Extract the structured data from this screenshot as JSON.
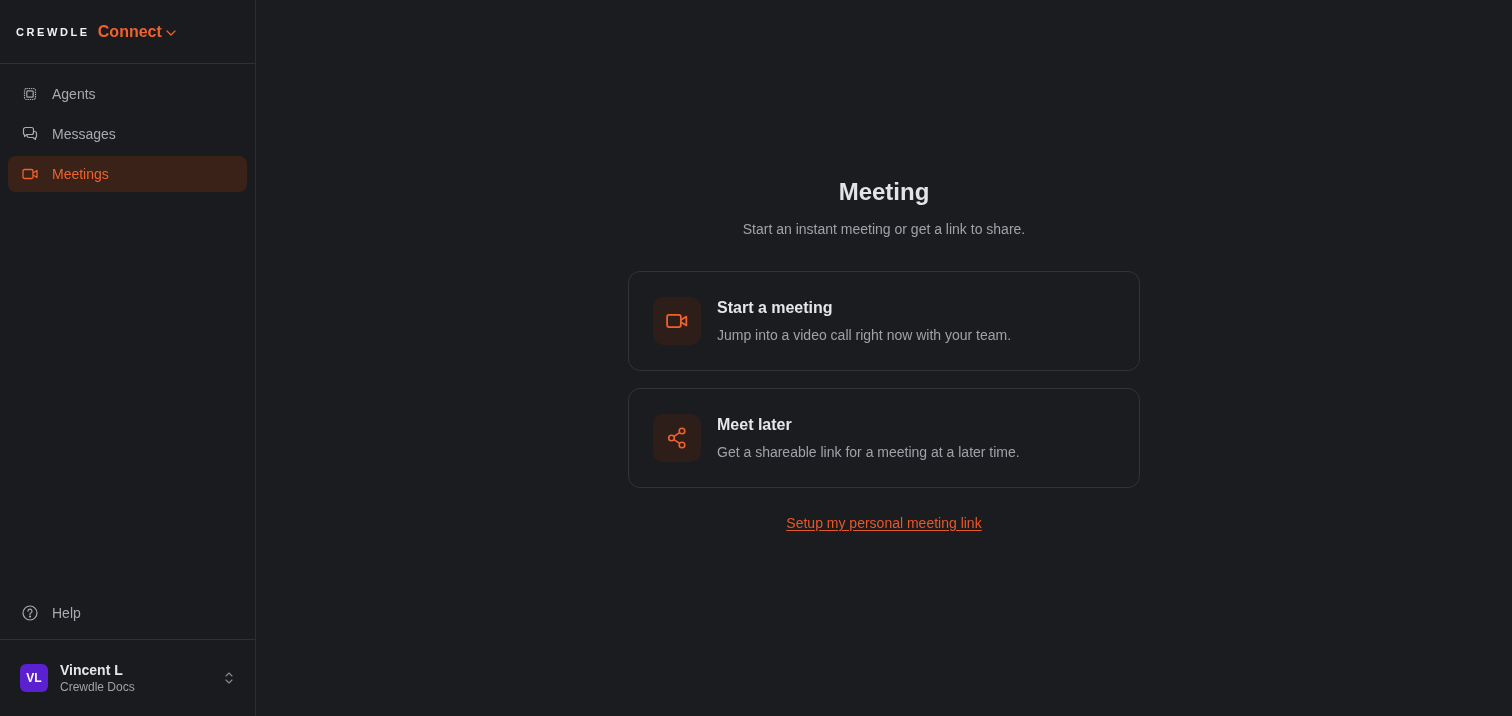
{
  "sidebar": {
    "brand": {
      "logo": "CREWDLE",
      "product": "Connect"
    },
    "items": [
      {
        "label": "Agents",
        "selected": false
      },
      {
        "label": "Messages",
        "selected": false
      },
      {
        "label": "Meetings",
        "selected": true
      }
    ],
    "help": "Help",
    "user": {
      "initials": "VL",
      "name": "Vincent L",
      "workspace": "Crewdle Docs"
    }
  },
  "main": {
    "title": "Meeting",
    "subtitle": "Start an instant meeting or get a link to share.",
    "options": [
      {
        "title": "Start a meeting",
        "description": "Jump into a video call right now with your team."
      },
      {
        "title": "Meet later",
        "description": "Get a shareable link for a meeting at a later time."
      }
    ],
    "link": "Setup my personal meeting link"
  }
}
